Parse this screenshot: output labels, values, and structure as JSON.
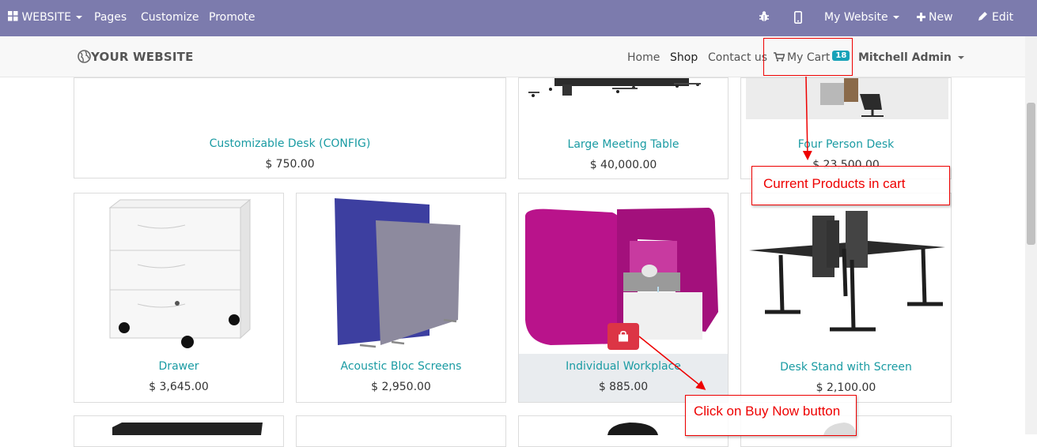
{
  "topbar": {
    "website_label": "WEBSITE",
    "pages_label": "Pages",
    "customize_label": "Customize",
    "promote_label": "Promote",
    "site_label": "My Website",
    "new_label": "New",
    "edit_label": "Edit"
  },
  "navbar": {
    "logo_text": "YOUR WEBSITE",
    "links": [
      "Home",
      "Shop",
      "Contact us"
    ],
    "cart_label": "My Cart",
    "cart_count": "18",
    "user_label": "Mitchell Admin"
  },
  "products": [
    {
      "name": "Customizable Desk (CONFIG)",
      "price": "$ 750.00"
    },
    {
      "name": "Large Meeting Table",
      "price": "$ 40,000.00"
    },
    {
      "name": "Four Person Desk",
      "price": "$ 23,500.00"
    },
    {
      "name": "Drawer",
      "price": "$ 3,645.00"
    },
    {
      "name": "Acoustic Bloc Screens",
      "price": "$ 2,950.00"
    },
    {
      "name": "Individual Workplace",
      "price": "$ 885.00"
    },
    {
      "name": "Desk Stand with Screen",
      "price": "$ 2,100.00"
    }
  ],
  "annotations": {
    "cart_note": "Current Products in cart",
    "buy_note": "Click on Buy Now button"
  },
  "colors": {
    "topbar": "#7c7bad",
    "accent": "#1a9ba3",
    "annotation": "#e00000",
    "buy_button": "#dc3545",
    "badge": "#17a2b8"
  }
}
